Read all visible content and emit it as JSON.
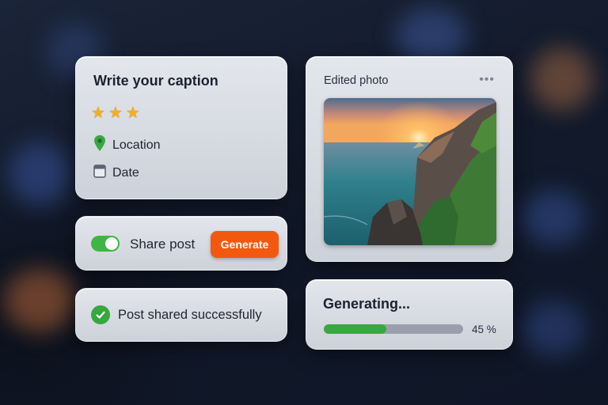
{
  "caption_card": {
    "title": "Write your caption",
    "stars": 3,
    "location_label": "Location",
    "location_icon": "map-pin-icon",
    "date_label": "Date",
    "date_icon": "calendar-icon"
  },
  "share_card": {
    "toggle_on": true,
    "label": "Share post",
    "button_label": "Generate",
    "button_color": "#f3580f"
  },
  "success_card": {
    "icon": "check-circle-icon",
    "label": "Post shared successfully"
  },
  "photo_card": {
    "title": "Edited photo",
    "menu_icon": "more-horizontal-icon"
  },
  "progress_card": {
    "title": "Generating...",
    "percent": 45,
    "percent_label": "45 %",
    "bar_color": "#3aa840"
  }
}
